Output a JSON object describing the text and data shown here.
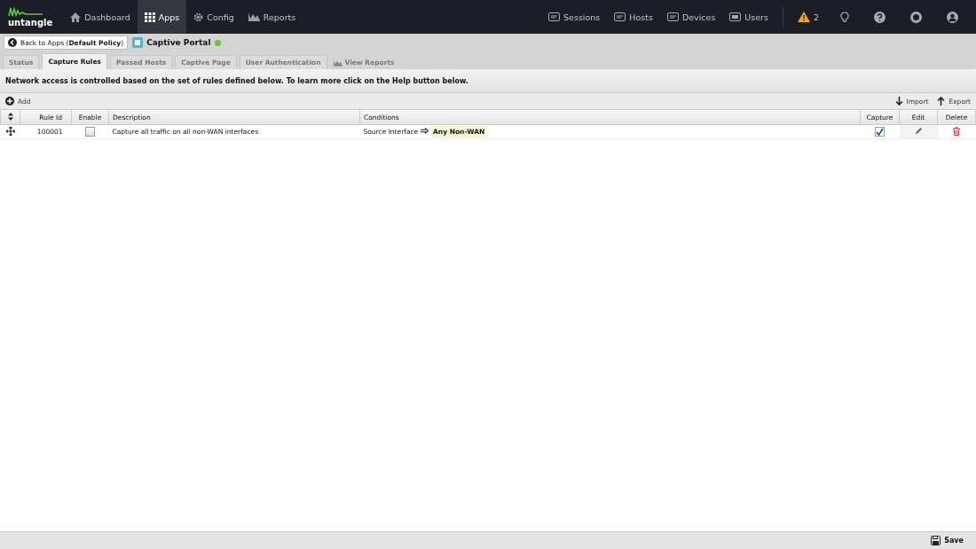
{
  "nav": {
    "logo": "untangle",
    "left": [
      {
        "label": "Dashboard",
        "selected": false
      },
      {
        "label": "Apps",
        "selected": true
      },
      {
        "label": "Config",
        "selected": false
      },
      {
        "label": "Reports",
        "selected": false
      }
    ],
    "right": [
      {
        "label": "Sessions"
      },
      {
        "label": "Hosts"
      },
      {
        "label": "Devices"
      },
      {
        "label": "Users"
      }
    ],
    "alert_count": "2"
  },
  "header": {
    "back_button": "Back to Apps (**Default Policy**)",
    "app_title": "Captive Portal",
    "running": true
  },
  "tabs": [
    {
      "label": "Status",
      "selected": false,
      "kind": "tab"
    },
    {
      "label": "Capture Rules",
      "selected": true,
      "kind": "tab"
    },
    {
      "label": "Passed Hosts",
      "selected": false,
      "kind": "tab"
    },
    {
      "label": "Captive Page",
      "selected": false,
      "kind": "tab"
    },
    {
      "label": "User Authentication",
      "selected": false,
      "kind": "tab"
    },
    {
      "label": "View Reports",
      "selected": false,
      "kind": "link"
    }
  ],
  "message": "Network access is controlled based on the set of rules defined below. To learn more click on the Help button below.",
  "toolbar": {
    "add": "Add",
    "import": "Import",
    "export": "Export"
  },
  "table": {
    "columns": [
      "Rule Id",
      "Enable",
      "Description",
      "Conditions",
      "Capture",
      "Edit",
      "Delete"
    ],
    "rows": [
      {
        "rule_id": "100001",
        "enable": false,
        "description": "Capture all traffic on all non-WAN interfaces",
        "condition_field": "Source Interface",
        "condition_value": "Any Non-WAN",
        "capture": true
      }
    ]
  },
  "footer": {
    "save": "Save"
  }
}
